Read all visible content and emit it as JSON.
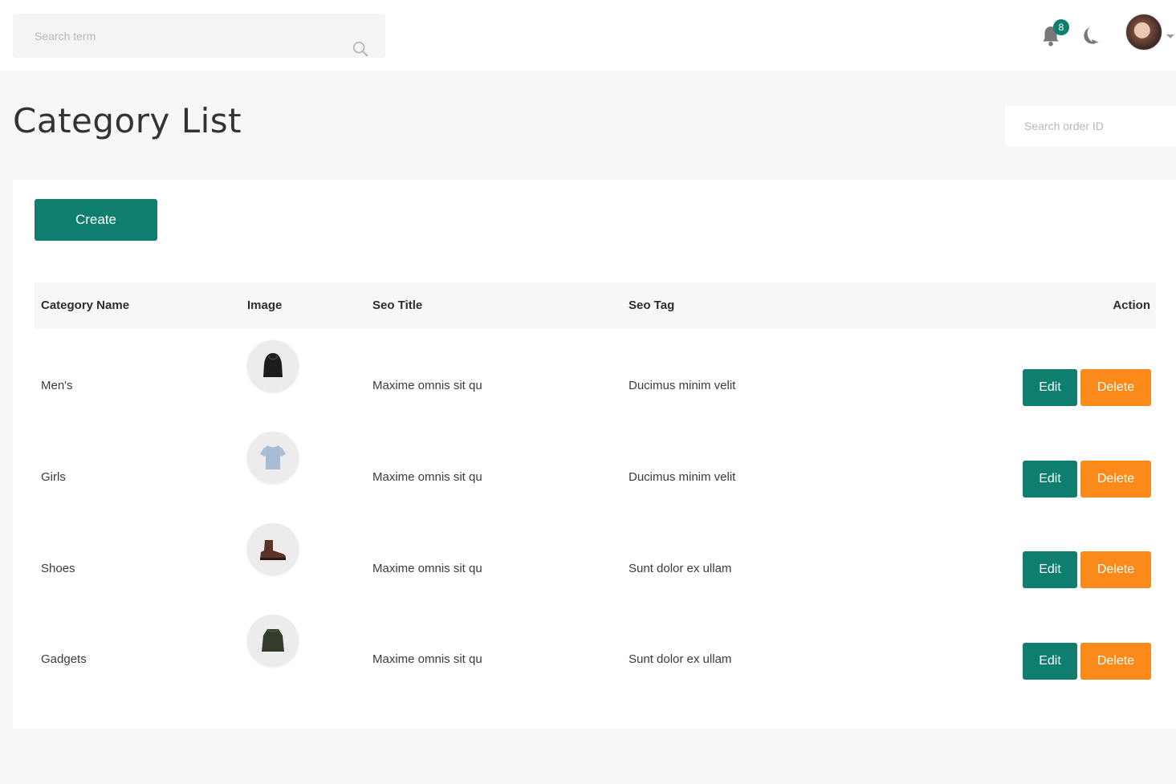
{
  "header": {
    "search_placeholder": "Search term",
    "notification_count": "8",
    "icons": [
      "search-icon",
      "bell-icon",
      "moon-icon",
      "avatar"
    ]
  },
  "page": {
    "title": "Category List",
    "order_search_placeholder": "Search order ID"
  },
  "toolbar": {
    "create_label": "Create"
  },
  "table": {
    "columns": [
      "Category Name",
      "Image",
      "Seo Title",
      "Seo Tag",
      "Action"
    ],
    "rows": [
      {
        "name": "Men's",
        "image": "hoodie-image",
        "seo_title": "Maxime omnis sit qu",
        "seo_tag": "Ducimus minim velit",
        "edit": "Edit",
        "delete": "Delete"
      },
      {
        "name": "Girls",
        "image": "tshirt-image",
        "seo_title": "Maxime omnis sit qu",
        "seo_tag": "Ducimus minim velit",
        "edit": "Edit",
        "delete": "Delete"
      },
      {
        "name": "Shoes",
        "image": "boot-image",
        "seo_title": "Maxime omnis sit qu",
        "seo_tag": "Sunt dolor ex ullam",
        "edit": "Edit",
        "delete": "Delete"
      },
      {
        "name": "Gadgets",
        "image": "jacket-image",
        "seo_title": "Maxime omnis sit qu",
        "seo_tag": "Sunt dolor ex ullam",
        "edit": "Edit",
        "delete": "Delete"
      }
    ]
  },
  "colors": {
    "primary": "#0f7e6f",
    "danger": "#fb8a1a",
    "background": "#f6f7f9"
  }
}
